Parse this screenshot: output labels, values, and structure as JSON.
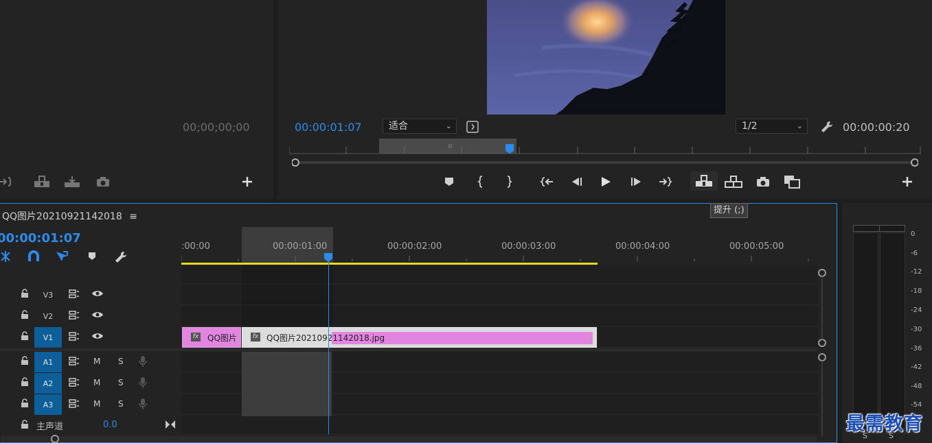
{
  "source_monitor": {
    "timecode": "00;00;00;00"
  },
  "program_monitor": {
    "timecode": "00:00:01:07",
    "fit_dropdown": "适合",
    "resolution_dropdown": "1/2",
    "duration": "00:00:00:20",
    "tooltip": "提升 (;)"
  },
  "timeline": {
    "title": "QQ图片20210921142018",
    "menu_glyph": "≡",
    "timecode": "00:00:01:07",
    "ruler_labels": [
      ":00:00",
      "00:00:01:00",
      "00:00:02:00",
      "00:00:03:00",
      "00:00:04:00",
      "00:00:05:00"
    ],
    "video_tracks": [
      {
        "label": "V3",
        "active": false
      },
      {
        "label": "V2",
        "active": false
      },
      {
        "label": "V1",
        "active": true
      }
    ],
    "audio_tracks": [
      {
        "label": "A1",
        "m": "M",
        "s": "S"
      },
      {
        "label": "A2",
        "m": "M",
        "s": "S"
      },
      {
        "label": "A3",
        "m": "M",
        "s": "S"
      }
    ],
    "master": {
      "label": "主声道",
      "value": "0.0"
    },
    "clips": {
      "clip1": {
        "fx": "fx",
        "name": "QQ图片"
      },
      "clip2": {
        "fx": "fx",
        "name": "QQ图片20210921142018.jpg"
      }
    }
  },
  "audio_meter": {
    "scale": [
      "0",
      "-6",
      "-12",
      "-18",
      "-24",
      "-30",
      "-36",
      "-42",
      "-48",
      "-54"
    ],
    "solo_left": "S",
    "solo_right": "S"
  },
  "watermark": "最需教育",
  "colors": {
    "accent_blue": "#2d8ceb",
    "timecode_blue": "#2d8ceb",
    "clip_pink": "#e185e1",
    "work_area_yellow": "#e6db1e",
    "track_on_blue": "#0c5f98"
  }
}
